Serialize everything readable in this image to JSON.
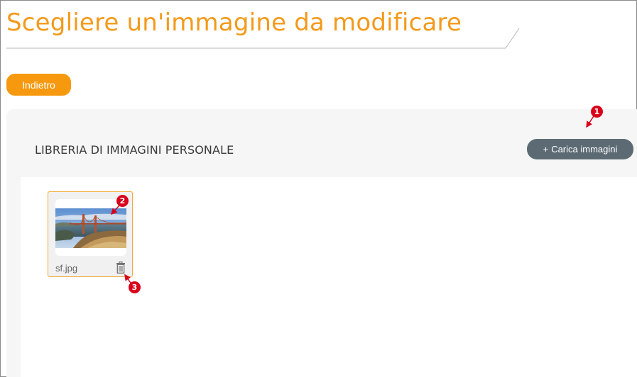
{
  "header": {
    "title": "Scegliere un'immagine da modificare"
  },
  "toolbar": {
    "back_label": "Indietro"
  },
  "library": {
    "title": "LIBRERIA DI IMMAGINI PERSONALE",
    "upload_label": "Carica immagini",
    "upload_icon": "+"
  },
  "images": [
    {
      "filename": "sf.jpg",
      "icon": "trash-icon"
    }
  ],
  "annotations": {
    "marker_1": "1",
    "marker_2": "2",
    "marker_3": "3"
  },
  "colors": {
    "accent": "#f39a1b",
    "back_button": "#f7990f",
    "upload_button": "#5c6b73",
    "marker": "#d9001b"
  }
}
